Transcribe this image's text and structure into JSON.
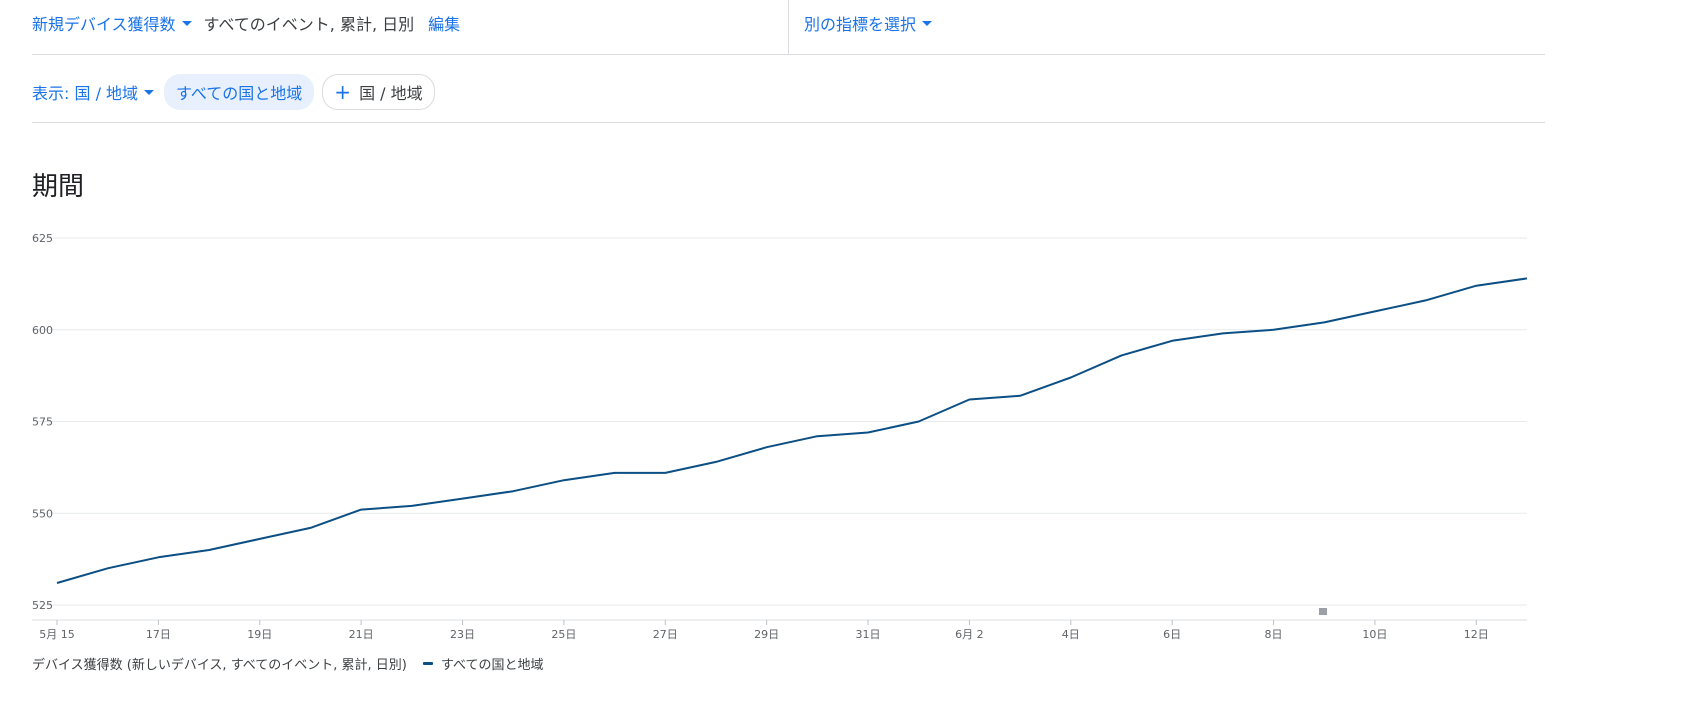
{
  "header": {
    "metric_label": "新規デバイス獲得数",
    "description": "すべてのイベント, 累計, 日別",
    "edit_label": "編集",
    "compare_label": "別の指標を選択"
  },
  "filters": {
    "show_label": "表示: 国 / 地域",
    "selected_chip": "すべての国と地域",
    "add_chip": "国 / 地域"
  },
  "section_title": "期間",
  "legend": {
    "metric_text": "デバイス獲得数 (新しいデバイス, すべてのイベント, 累計, 日別)",
    "series_label": "すべての国と地域"
  },
  "chart_data": {
    "type": "line",
    "title": "",
    "xlabel": "",
    "ylabel": "",
    "ylim": [
      525,
      625
    ],
    "yticks": [
      625,
      600,
      575,
      550,
      525
    ],
    "grid": true,
    "x": [
      "5月15",
      "5月16",
      "5月17",
      "5月18",
      "5月19",
      "5月20",
      "5月21",
      "5月22",
      "5月23",
      "5月24",
      "5月25",
      "5月26",
      "5月27",
      "5月28",
      "5月29",
      "5月30",
      "5月31",
      "6月1",
      "6月2",
      "6月3",
      "6月4",
      "6月5",
      "6月6",
      "6月7",
      "6月8",
      "6月9",
      "6月10",
      "6月11",
      "6月12",
      "6月13"
    ],
    "xtick_labels": [
      {
        "index": 0,
        "label": "5月 15"
      },
      {
        "index": 2,
        "label": "17日"
      },
      {
        "index": 4,
        "label": "19日"
      },
      {
        "index": 6,
        "label": "21日"
      },
      {
        "index": 8,
        "label": "23日"
      },
      {
        "index": 10,
        "label": "25日"
      },
      {
        "index": 12,
        "label": "27日"
      },
      {
        "index": 14,
        "label": "29日"
      },
      {
        "index": 16,
        "label": "31日"
      },
      {
        "index": 18,
        "label": "6月 2"
      },
      {
        "index": 20,
        "label": "4日"
      },
      {
        "index": 22,
        "label": "6日"
      },
      {
        "index": 24,
        "label": "8日"
      },
      {
        "index": 26,
        "label": "10日"
      },
      {
        "index": 28,
        "label": "12日"
      }
    ],
    "series": [
      {
        "name": "すべての国と地域",
        "color": "#0b4f84",
        "values": [
          531,
          535,
          538,
          540,
          543,
          546,
          551,
          552,
          554,
          556,
          559,
          561,
          561,
          564,
          568,
          571,
          572,
          575,
          581,
          582,
          587,
          593,
          597,
          599,
          600,
          602,
          605,
          608,
          612,
          614
        ]
      }
    ]
  }
}
